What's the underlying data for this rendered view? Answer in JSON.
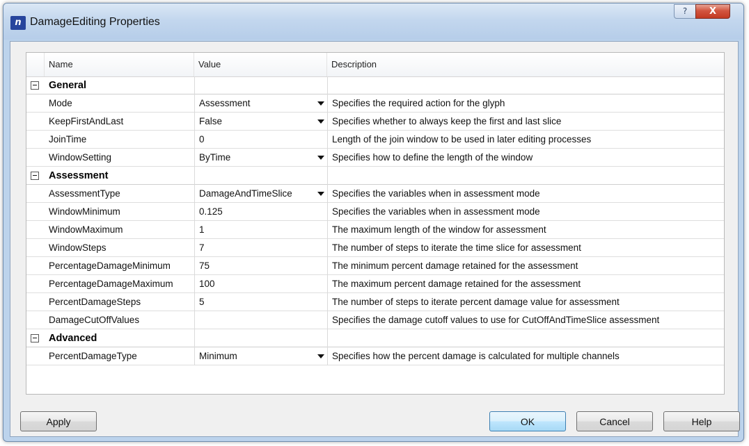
{
  "window": {
    "title": "DamageEditing Properties",
    "help_glyph": "?",
    "close_glyph": "X"
  },
  "grid": {
    "headers": {
      "name": "Name",
      "value": "Value",
      "description": "Description"
    },
    "rows": [
      {
        "type": "group",
        "name": "General"
      },
      {
        "type": "prop",
        "name": "Mode",
        "value": "Assessment",
        "dropdown": true,
        "description": "Specifies the required action for the glyph"
      },
      {
        "type": "prop",
        "name": "KeepFirstAndLast",
        "value": "False",
        "dropdown": true,
        "description": "Specifies whether to always keep the first and last slice"
      },
      {
        "type": "prop",
        "name": "JoinTime",
        "value": "0",
        "dropdown": false,
        "description": "Length of the join window to be used in later editing processes"
      },
      {
        "type": "prop",
        "name": "WindowSetting",
        "value": "ByTime",
        "dropdown": true,
        "description": "Specifies how to define the length of the window"
      },
      {
        "type": "group",
        "name": "Assessment"
      },
      {
        "type": "prop",
        "name": "AssessmentType",
        "value": "DamageAndTimeSlice",
        "dropdown": true,
        "description": "Specifies the variables when in assessment mode"
      },
      {
        "type": "prop",
        "name": "WindowMinimum",
        "value": "0.125",
        "dropdown": false,
        "description": "Specifies the variables when in assessment mode"
      },
      {
        "type": "prop",
        "name": "WindowMaximum",
        "value": "1",
        "dropdown": false,
        "description": "The maximum length of the window for assessment"
      },
      {
        "type": "prop",
        "name": "WindowSteps",
        "value": "7",
        "dropdown": false,
        "description": "The number of steps to iterate the time slice for assessment"
      },
      {
        "type": "prop",
        "name": "PercentageDamageMinimum",
        "value": "75",
        "dropdown": false,
        "description": "The minimum percent damage retained for the assessment"
      },
      {
        "type": "prop",
        "name": "PercentageDamageMaximum",
        "value": "100",
        "dropdown": false,
        "description": "The maximum percent damage retained for the assessment"
      },
      {
        "type": "prop",
        "name": "PercentDamageSteps",
        "value": "5",
        "dropdown": false,
        "description": "The number of steps to iterate percent damage value for assessment"
      },
      {
        "type": "prop",
        "name": "DamageCutOffValues",
        "value": "",
        "dropdown": false,
        "description": "Specifies the damage cutoff values to use for CutOffAndTimeSlice assessment"
      },
      {
        "type": "group",
        "name": "Advanced"
      },
      {
        "type": "prop",
        "name": "PercentDamageType",
        "value": "Minimum",
        "dropdown": true,
        "description": "Specifies how the percent damage is calculated for multiple channels"
      }
    ]
  },
  "buttons": {
    "apply": "Apply",
    "ok": "OK",
    "cancel": "Cancel",
    "help": "Help"
  },
  "colors": {
    "title_bar": "#c3d7ee",
    "close_button": "#c94a33",
    "default_button_border": "#3c7fb1"
  }
}
